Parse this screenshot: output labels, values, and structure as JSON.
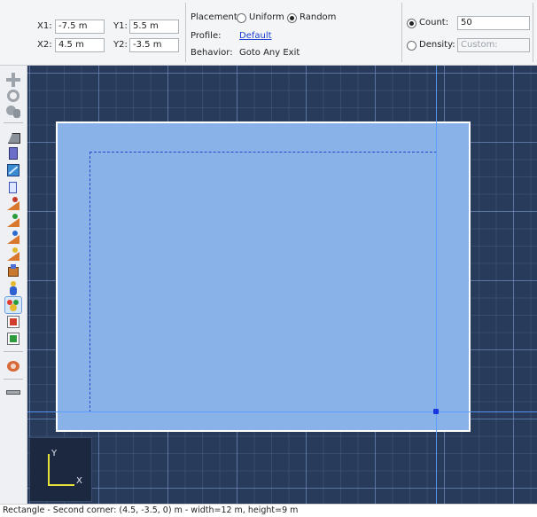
{
  "props": {
    "x1": {
      "label": "X1:",
      "value": "-7.5 m"
    },
    "y1": {
      "label": "Y1:",
      "value": "5.5 m"
    },
    "x2": {
      "label": "X2:",
      "value": "4.5 m"
    },
    "y2": {
      "label": "Y2:",
      "value": "-3.5 m"
    },
    "placement_label": "Placement:",
    "placement_uniform": "Uniform",
    "placement_random": "Random",
    "placement_selected": "Random",
    "profile_label": "Profile:",
    "profile_value": "Default",
    "behavior_label": "Behavior:",
    "behavior_value": "Goto Any Exit",
    "count_label": "Count:",
    "count_value": "50",
    "density_label": "Density:",
    "density_placeholder": "Custom:",
    "quantity_mode_selected": "Count"
  },
  "toolbar": {
    "tools": [
      {
        "name": "pan-tool-icon",
        "active": false
      },
      {
        "name": "orbit-tool-icon",
        "active": false
      },
      {
        "name": "zoom-tool-icon",
        "active": false
      },
      {
        "name": "floor-tool-icon",
        "active": false
      },
      {
        "name": "wall-tool-icon",
        "active": false
      },
      {
        "name": "obstruction-tool-icon",
        "active": false
      },
      {
        "name": "door-tool-icon",
        "active": false
      },
      {
        "name": "stair-tool-1-icon",
        "active": false
      },
      {
        "name": "stair-tool-2-icon",
        "active": false
      },
      {
        "name": "stair-tool-3-icon",
        "active": false
      },
      {
        "name": "stair-tool-4-icon",
        "active": false
      },
      {
        "name": "exit-tool-icon",
        "active": false
      },
      {
        "name": "occupant-tool-icon",
        "active": false
      },
      {
        "name": "occupant-group-tool-icon",
        "active": true
      },
      {
        "name": "target-tool-1-icon",
        "active": false
      },
      {
        "name": "target-tool-2-icon",
        "active": false
      },
      {
        "name": "camera-tool-icon",
        "active": false
      },
      {
        "name": "measure-tool-icon",
        "active": false
      }
    ]
  },
  "viewport": {
    "axes": {
      "y_label": "Y",
      "x_label": "X"
    },
    "colors": {
      "grid_background": "#283b5a",
      "region_fill": "#89b2e9",
      "guide": "#5b9bff"
    }
  },
  "status_text": "Rectangle - Second corner: (4.5, -3.5, 0) m - width=12 m, height=9 m"
}
